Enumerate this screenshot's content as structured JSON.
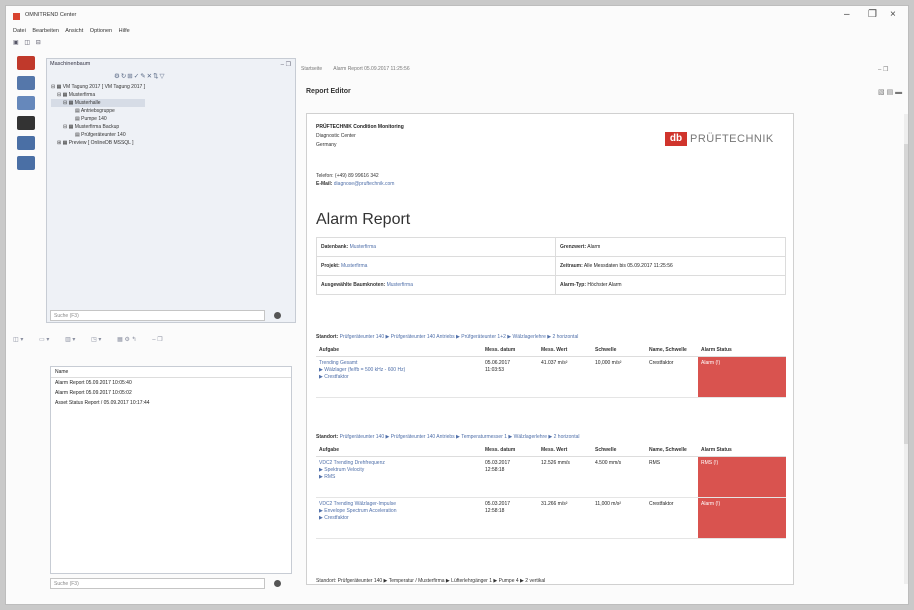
{
  "app": {
    "title": "OMNITREND Center"
  },
  "menu": [
    "Datei",
    "Bearbeiten",
    "Ansicht",
    "Optionen",
    "Hilfe"
  ],
  "window_controls": {
    "minimize": "–",
    "restore": "❐",
    "close": "×"
  },
  "tree_panel": {
    "tab_label": "Maschinenbaum",
    "items": [
      "VM Tagung 2017 [ VM Tagung 2017 ]",
      "Musterfirma",
      "Musterhalle",
      "Antriebsgruppe",
      "Pumpe 140",
      "Musterfirma Backup",
      "Prüfgeräteunter 140",
      "Preview [ OnlineDB MSSQL ]"
    ],
    "search_placeholder": "Suche (F3)"
  },
  "report_list": {
    "header": "Name",
    "items": [
      "Alarm Report 05.09.2017 10:05:40",
      "Alarm Report 05.09.2017 10:05:02",
      "Asset Status Report / 05.09.2017 10:17:44"
    ],
    "search_placeholder": "Suche (F3)"
  },
  "editor": {
    "tabs": [
      "Startseite",
      "Alarm Report 05.09.2017 11:25:56"
    ],
    "title": "Report Editor"
  },
  "report": {
    "company": "PRÜFTECHNIK Condition Monitoring",
    "dept": "Diagnostic Center",
    "country": "Germany",
    "telefon": "Telefon: (+49) 89 99616 342",
    "email_label": "E-Mail:",
    "email": "diagnose@pruftechnik.com",
    "logo_mark": "db",
    "logo_text": "PRÜFTECHNIK",
    "heading": "Alarm Report",
    "db_label": "Datenbank:",
    "db_value": "Musterfirma",
    "grenz_label": "Grenzwert:",
    "grenz_value": "Alarm",
    "projekt_label": "Projekt:",
    "projekt_value": "Musterfirma",
    "zeit_label": "Zeitraum:",
    "zeit_value": "Alle Messdaten bis 05.09.2017 11:25:56",
    "auswahl_label": "Ausgewählte Baumknoten:",
    "auswahl_value": "Musterfirma",
    "alarmtyp_label": "Alarm-Typ:",
    "alarmtyp_value": "Höchster Alarm",
    "sections": [
      {
        "label": "Standort:",
        "path": "Prüfgeräteunter 140 ▶ Prüfgeräteunter 140 Antriebs ▶ Prüfgeräteunter 1+2 ▶ Wälzlagerlehre ▶ 2 horizontal",
        "headers": [
          "Aufgabe",
          "Mess. datum",
          "Mess. Wert",
          "Schwelle",
          "Name, Schwelle",
          "Alarm Status"
        ],
        "rows": [
          {
            "task": "Trending Gesamt",
            "sub1": "▶ Wälzlager (fe/fb = 500 kHz - 600 Hz)",
            "sub2": "▶ Crestfaktor",
            "date": "05.06.2017",
            "time": "11:03:53",
            "value": "41.037 m/s²",
            "thr": "10,000 m/s²",
            "name": "Crestfaktor",
            "status": "Alarm (!)"
          }
        ]
      },
      {
        "label": "Standort:",
        "path": "Prüfgeräteunter 140 ▶ Prüfgeräteunter 140 Antriebs ▶ Temperaturmesser 1 ▶ Wälzlagerlehre ▶ 2 horizontal",
        "headers": [
          "Aufgabe",
          "Mess. datum",
          "Mess. Wert",
          "Schwelle",
          "Name, Schwelle",
          "Alarm Status"
        ],
        "rows": [
          {
            "task": "VDC2 Trending Drehfrequenz",
            "sub1": "▶ Spektrum Velocity",
            "sub2": "▶ RMS",
            "date": "05.03.2017",
            "time": "12:58:18",
            "value": "12.526 mm/s",
            "thr": "4.500 mm/s",
            "name": "RMS",
            "status": "RMS (!)"
          },
          {
            "task": "VDC2 Trending Wälzlager-Impulse",
            "sub1": "▶ Envelope Spectrum Acceleration",
            "sub2": "▶ Crestfaktor",
            "date": "05.03.2017",
            "time": "12:58:18",
            "value": "31.266 m/s²",
            "thr": "11,000 m/s²",
            "name": "Crestfaktor",
            "status": "Alarm (!)"
          }
        ]
      }
    ],
    "next_section": "Standort: Prüfgeräteunter 140 ▶ Temperatur / Musterfirma ▶ Lüfterlehrgänger 1 ▶ Pumpe 4 ▶ 2 vertikal"
  },
  "colors": {
    "alarm": "#d9534f",
    "accent": "#4f6fa9",
    "brand": "#d0342c"
  }
}
